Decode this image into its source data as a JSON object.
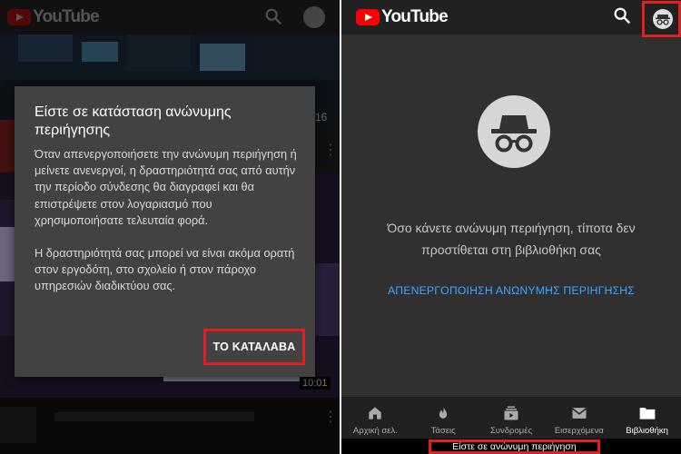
{
  "left_panel": {
    "app_name": "YouTube",
    "side_number": "16",
    "video_duration": "10:01",
    "dialog": {
      "title": "Είστε σε κατάσταση ανώνυμης περιήγησης",
      "paragraph_1": "Όταν απενεργοποιήσετε την ανώνυμη περιήγηση ή μείνετε ανενεργοί, η δραστηριότητά σας από αυτήν την περίοδο σύνδεσης θα διαγραφεί και θα επιστρέψετε στον λογαριασμό που χρησιμοποιήσατε τελευταία φορά.",
      "paragraph_2": "Η δραστηριότητά σας μπορεί να είναι ακόμα ορατή στον εργοδότη, στο σχολείο ή στον πάροχο υπηρεσιών διαδικτύου σας.",
      "confirm_label": "ΤΟ ΚΑΤΑΛΑΒΑ"
    }
  },
  "right_panel": {
    "app_name": "YouTube",
    "message": "Όσο κάνετε ανώνυμη περιήγηση, τίποτα δεν προστίθεται στη βιβλιοθήκη σας",
    "turn_off_link": "ΑΠΕΝΕΡΓΟΠΟΙΗΣΗ ΑΝΩΝΥΜΗΣ ΠΕΡΙΗΓΗΣΗΣ",
    "nav": [
      {
        "label": "Αρχική σελ.",
        "icon": "home-icon"
      },
      {
        "label": "Τάσεις",
        "icon": "trending-icon"
      },
      {
        "label": "Συνδρομές",
        "icon": "subscriptions-icon"
      },
      {
        "label": "Εισερχόμενα",
        "icon": "inbox-icon"
      },
      {
        "label": "Βιβλιοθήκη",
        "icon": "library-icon",
        "active": true
      }
    ],
    "status_text": "Είστε σε ανώνυμη περιήγηση"
  },
  "colors": {
    "brand_red": "#ff0000",
    "highlight_red": "#e02020",
    "link_blue": "#3ea6ff",
    "dark_bg": "#303030"
  }
}
